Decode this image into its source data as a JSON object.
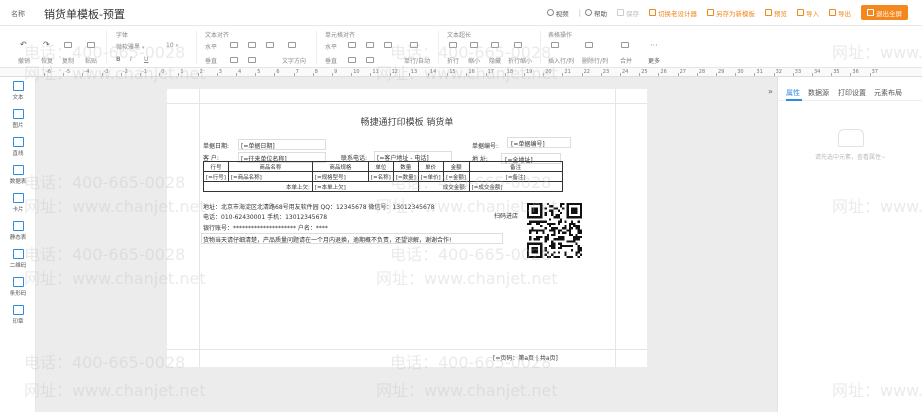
{
  "header": {
    "name_label": "名称",
    "title": "销货单模板-预置",
    "actions": [
      {
        "label": "视频",
        "icon": "video-icon"
      },
      {
        "label": "帮助",
        "icon": "help-icon"
      },
      {
        "label": "保存",
        "icon": "save-icon"
      },
      {
        "label": "切换老设计器",
        "icon": "switch-icon"
      },
      {
        "label": "另存为新模板",
        "icon": "save-as-icon"
      },
      {
        "label": "预览",
        "icon": "preview-icon"
      },
      {
        "label": "导入",
        "icon": "import-icon"
      },
      {
        "label": "导出",
        "icon": "export-icon"
      },
      {
        "label": "退出全屏",
        "icon": "exit-fullscreen-icon"
      }
    ],
    "separator": "|"
  },
  "toolbar": {
    "groups": [
      "字体",
      "文本对齐",
      "单元格对齐",
      "文本超长",
      "表格操作"
    ],
    "edit": {
      "undo": "撤销",
      "redo": "恢复",
      "copy": "复制",
      "paste": "粘贴"
    },
    "font_family": "微软雅黑",
    "font_size": "10",
    "bold": "B",
    "italic": "I",
    "underline": "U",
    "text_align": {
      "left": "水平",
      "vertical": "垂直",
      "direction": "文字方向"
    },
    "cell_align": {
      "horizontal": "水平",
      "vertical": "垂直",
      "wrap": "单行/自动"
    },
    "overflow": {
      "wrap": "折行",
      "shrink": "缩小",
      "clip": "隐藏",
      "break": "折行缩小"
    },
    "table_ops": {
      "insert": "插入行/列",
      "delete": "删除行/列",
      "merge": "合并",
      "more": "更多"
    }
  },
  "ruler": {
    "ticks": [
      "-6",
      "-5",
      "-4",
      "-3",
      "-2",
      "-1",
      "0",
      "1",
      "2",
      "3",
      "4",
      "5",
      "6",
      "7",
      "8",
      "9",
      "10",
      "11",
      "12",
      "13",
      "14",
      "15",
      "16",
      "17",
      "18",
      "19",
      "20",
      "21",
      "22",
      "23",
      "24",
      "25",
      "26",
      "27",
      "28",
      "29",
      "30",
      "31",
      "32",
      "33",
      "34",
      "35",
      "36",
      "37"
    ]
  },
  "sidebar": {
    "items": [
      {
        "label": "文本",
        "icon": "text-icon"
      },
      {
        "label": "图片",
        "icon": "image-icon"
      },
      {
        "label": "直线",
        "icon": "line-icon"
      },
      {
        "label": "数据表",
        "icon": "data-table-icon"
      },
      {
        "label": "卡片",
        "icon": "card-icon"
      },
      {
        "label": "静态表",
        "icon": "static-table-icon"
      },
      {
        "label": "二维码",
        "icon": "qrcode-icon"
      },
      {
        "label": "条形码",
        "icon": "barcode-icon"
      },
      {
        "label": "印章",
        "icon": "seal-icon"
      }
    ]
  },
  "document": {
    "title": "畅捷通打印模板  销货单",
    "fields": {
      "date_label": "单据日期:",
      "date_value": "[=单据日期]",
      "number_label": "单据编号:",
      "number_value": "[=单据编号]",
      "customer_label": "客  户:",
      "customer_value": "[=往来单位名称]",
      "phone_label": "联系电话:",
      "phone_value": "[=客户地址 - 电话]",
      "address_label": "地  址:",
      "address_value": "[=全地址]"
    },
    "table": {
      "headers": [
        "行号",
        "商品名称",
        "商品规格",
        "单位",
        "数量",
        "单价",
        "金额",
        "备注"
      ],
      "row": [
        "[=行号]",
        "[=商品名称]",
        "[=规格型号]",
        "[=名称]",
        "[=数量]",
        "[=单价]",
        "[=金额]",
        "[=备注]"
      ],
      "summary": {
        "last_label": "本单上欠:",
        "last_value": "[=本单上欠]",
        "deal_label": "成交金额:",
        "deal_value": "[=成交金额]"
      }
    },
    "footer_lines": [
      "地址：北京市海淀区北清路68号用友软件园  QQ：12345678  微信号：13012345678",
      "电话：010-62430001  手机：13012345678",
      "银行账号：*********************  户名：****",
      "货物当天请仔细清楚，产品质量问题请在一个月内退换，逾期概不负责，还望谅解，谢谢合作!"
    ],
    "scan_label": "扫码进店",
    "page_number": "[=页码：第a页  |  共a页]"
  },
  "right_panel": {
    "collapse_icon": "»",
    "tabs": [
      "属性",
      "数据源",
      "打印设置",
      "元素布局"
    ],
    "active_tab": 0,
    "empty_text": "请先选中元素，查看属性~"
  },
  "watermark": {
    "phone": "电话：400-665-0028",
    "site": "网址：www.chanjet.net"
  }
}
